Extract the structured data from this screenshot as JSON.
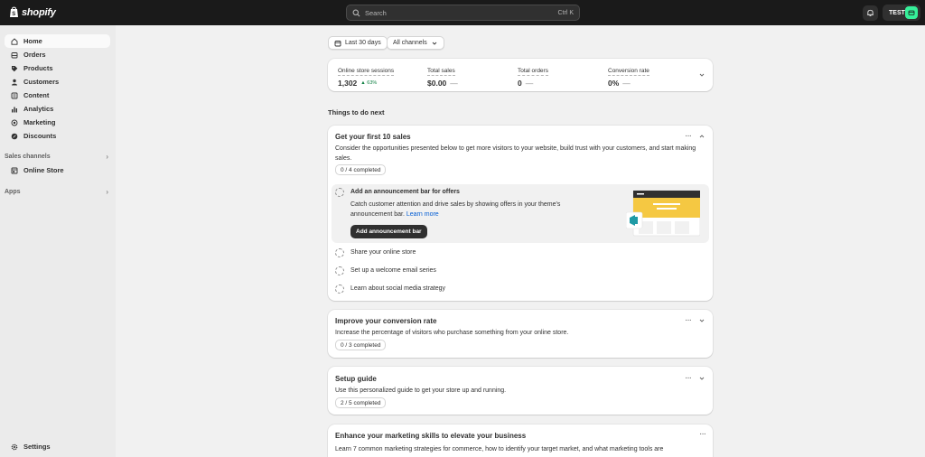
{
  "topbar": {
    "brand": "shopify",
    "search_placeholder": "Search",
    "search_shortcut": "Ctrl K",
    "store_name": "TEST"
  },
  "sidebar": {
    "items": [
      {
        "label": "Home",
        "icon": "home-icon"
      },
      {
        "label": "Orders",
        "icon": "orders-icon"
      },
      {
        "label": "Products",
        "icon": "tag-icon"
      },
      {
        "label": "Customers",
        "icon": "person-icon"
      },
      {
        "label": "Content",
        "icon": "content-icon"
      },
      {
        "label": "Analytics",
        "icon": "bar-chart-icon"
      },
      {
        "label": "Marketing",
        "icon": "target-icon"
      },
      {
        "label": "Discounts",
        "icon": "discount-icon"
      }
    ],
    "sales_channels_label": "Sales channels",
    "online_store_label": "Online Store",
    "apps_label": "Apps",
    "settings_label": "Settings"
  },
  "filters": {
    "date_range": "Last 30 days",
    "channels": "All channels"
  },
  "metrics": [
    {
      "label": "Online store sessions",
      "value": "1,302",
      "change": "63%"
    },
    {
      "label": "Total sales",
      "value": "$0.00",
      "change": "—"
    },
    {
      "label": "Total orders",
      "value": "0",
      "change": "—"
    },
    {
      "label": "Conversion rate",
      "value": "0%",
      "change": "—"
    }
  ],
  "things_to_do": {
    "heading": "Things to do next",
    "first_sales": {
      "title": "Get your first 10 sales",
      "description": "Consider the opportunities presented below to get more visitors to your website, build trust with your customers, and start making sales.",
      "progress": "0 / 4 completed",
      "tasks": [
        {
          "title": "Add an announcement bar for offers",
          "description": "Catch customer attention and drive sales by showing offers in your theme's announcement bar.",
          "link": "Learn more",
          "button": "Add announcement bar"
        },
        {
          "title": "Share your online store"
        },
        {
          "title": "Set up a welcome email series"
        },
        {
          "title": "Learn about social media strategy"
        }
      ]
    },
    "conversion": {
      "title": "Improve your conversion rate",
      "description": "Increase the percentage of visitors who purchase something from your online store.",
      "progress": "0 / 3 completed"
    },
    "setup": {
      "title": "Setup guide",
      "description": "Use this personalized guide to get your store up and running.",
      "progress": "2 / 5 completed"
    },
    "marketing": {
      "title": "Enhance your marketing skills to elevate your business",
      "description": "Learn 7 common marketing strategies for commerce, how to identify your target market, and what marketing tools are"
    }
  },
  "colors": {
    "topbar": "#1a1a1a",
    "accent_green": "#36f09a",
    "link_blue": "#005bd3",
    "announcement_yellow": "#f5c842",
    "megaphone_teal": "#1f9aa5"
  }
}
